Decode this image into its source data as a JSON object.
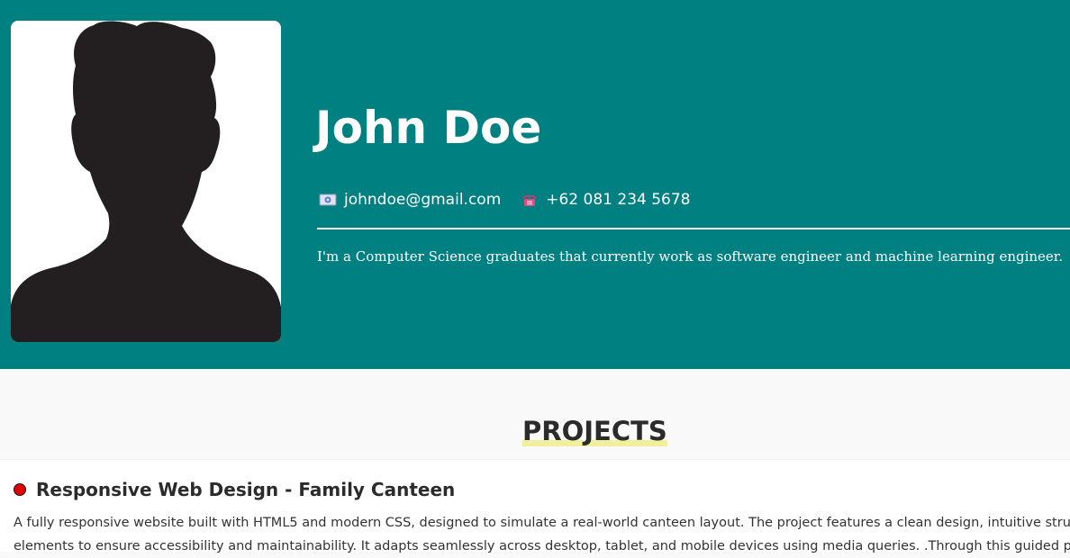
{
  "profile": {
    "name": "John Doe",
    "email": "johndoe@gmail.com",
    "phone": "+62 081 234 5678",
    "email_icon": "email-icon",
    "phone_icon": "telephone-icon",
    "bio": "I'm a Computer Science graduates that currently work as software engineer and machine learning engineer.",
    "avatar_icon": "person-silhouette"
  },
  "projects": {
    "heading": "PROJECTS",
    "items": [
      {
        "title": "Responsive Web Design - Family Canteen",
        "description_lines": [
          "A fully responsive website built with HTML5 and modern CSS, designed to simulate a real-world canteen layout. The project features a clean design, intuitive structure",
          "elements to ensure accessibility and maintainability. It adapts seamlessly across desktop, tablet, and mobile devices using media queries. .Through this guided project"
        ]
      }
    ]
  },
  "colors": {
    "hero_background": "#008080",
    "page_background": "#f9f9f9",
    "heading_highlight": "#f1ef9b",
    "bullet": "#e30000",
    "text_dark": "#2b2b2b"
  }
}
